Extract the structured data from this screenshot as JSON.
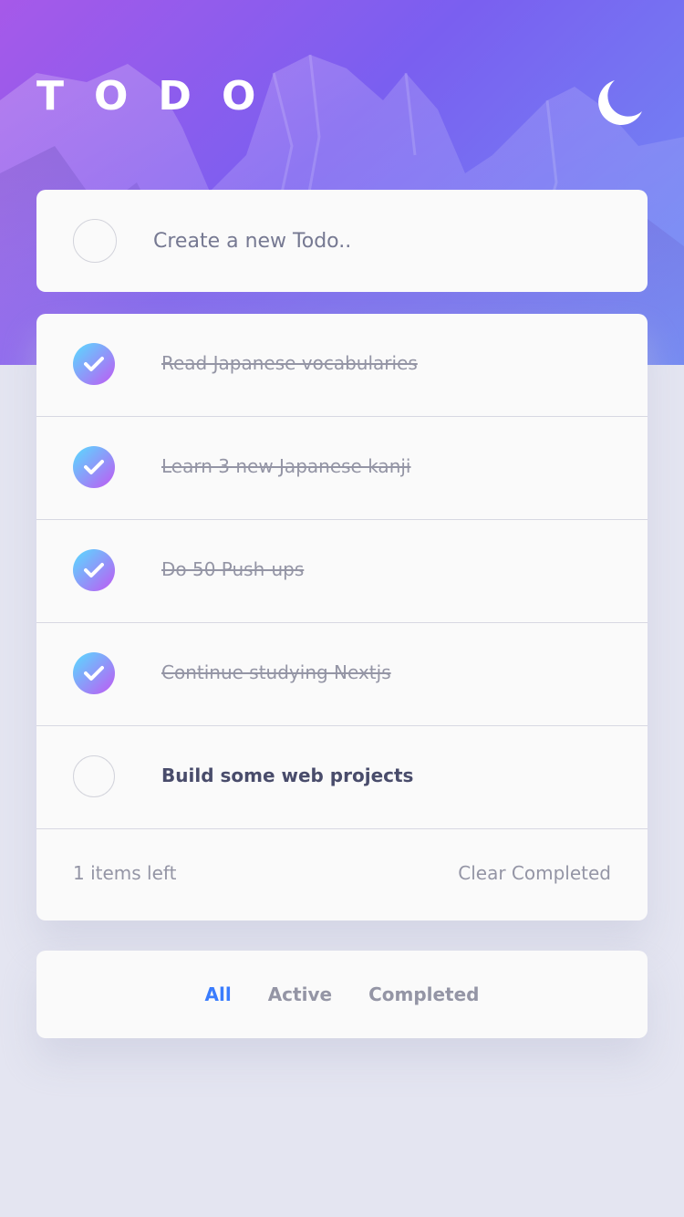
{
  "app": {
    "title": "TODO",
    "theme_icon": "moon-icon",
    "background_image": "purple-gradient-mountains",
    "colors": {
      "accent": "#3a7cfd",
      "check_gradient_start": "#57ddff",
      "check_gradient_end": "#c058f3",
      "page_background": "#e4e5f1",
      "card_background": "#fafafa",
      "completed_text": "#9495a5",
      "active_text": "#494c6b"
    }
  },
  "new_todo": {
    "placeholder": "Create a new Todo.."
  },
  "todos": [
    {
      "text": "Read Japanese vocabularies",
      "completed": true
    },
    {
      "text": "Learn 3 new Japanese kanji",
      "completed": true
    },
    {
      "text": "Do 50 Push-ups",
      "completed": true
    },
    {
      "text": "Continue studying Nextjs",
      "completed": true
    },
    {
      "text": "Build some web projects",
      "completed": false
    }
  ],
  "footer": {
    "items_left": "1 items left",
    "clear_completed": "Clear Completed"
  },
  "filters": [
    {
      "label": "All",
      "selected": true
    },
    {
      "label": "Active",
      "selected": false
    },
    {
      "label": "Completed",
      "selected": false
    }
  ]
}
